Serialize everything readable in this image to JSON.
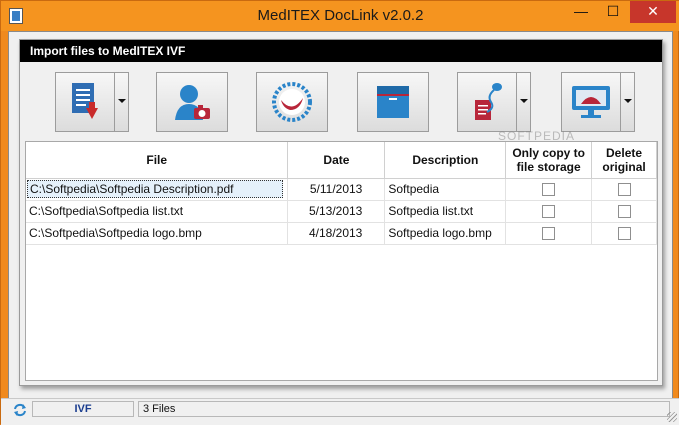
{
  "window": {
    "title": "MedITEX DocLink v2.0.2",
    "min_glyph": "—",
    "max_glyph": "☐",
    "close_glyph": "✕"
  },
  "panel": {
    "title": "Import files to MedITEX IVF"
  },
  "toolbar": {
    "buttons": [
      {
        "icon": "document-import-icon",
        "has_dropdown": true
      },
      {
        "icon": "patient-photo-icon",
        "has_dropdown": false
      },
      {
        "icon": "oocyte-icon",
        "has_dropdown": false
      },
      {
        "icon": "folder-icon",
        "has_dropdown": false
      },
      {
        "icon": "sperm-document-icon",
        "has_dropdown": true
      },
      {
        "icon": "ultrasound-monitor-icon",
        "has_dropdown": true
      }
    ]
  },
  "watermark": "SOFTPEDIA",
  "table": {
    "headers": {
      "file": "File",
      "date": "Date",
      "description": "Description",
      "copy_line1": "Only copy to",
      "copy_line2": "file storage",
      "delete_line1": "Delete",
      "delete_line2": "original"
    },
    "rows": [
      {
        "file": "C:\\Softpedia\\Softpedia Description.pdf",
        "date": "5/11/2013",
        "description": "Softpedia",
        "copy": false,
        "delete": false,
        "selected": true
      },
      {
        "file": "C:\\Softpedia\\Softpedia list.txt",
        "date": "5/13/2013",
        "description": "Softpedia list.txt",
        "copy": false,
        "delete": false,
        "selected": false
      },
      {
        "file": "C:\\Softpedia\\Softpedia logo.bmp",
        "date": "4/18/2013",
        "description": "Softpedia logo.bmp",
        "copy": false,
        "delete": false,
        "selected": false
      }
    ]
  },
  "statusbar": {
    "module": "IVF",
    "file_count": "3 Files"
  },
  "colors": {
    "titlebar": "#f5941f",
    "close_button": "#c7362b",
    "panel_header": "#000000",
    "status_module_text": "#1a3d8f"
  }
}
